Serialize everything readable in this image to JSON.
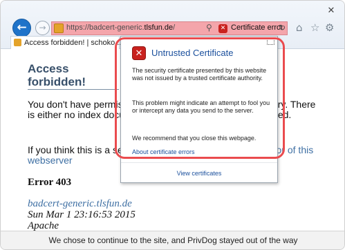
{
  "window": {
    "close_glyph": "✕"
  },
  "toolbar": {
    "back_glyph": "←",
    "forward_glyph": "→",
    "home_icon": "⌂",
    "favorites_icon": "☆",
    "settings_icon": "⚙"
  },
  "address_bar": {
    "url_prefix": "https://badcert-generic.",
    "url_domain": "tlsfun.de",
    "url_suffix": "/",
    "search_glyph": "⚲",
    "shield_glyph": "✕",
    "cert_error_label": "Certificate error",
    "refresh_glyph": "↻"
  },
  "tab": {
    "label": "Access forbidden! | schoko..."
  },
  "page": {
    "title": "Access forbidden!",
    "para1": "You don't have permission to access the requested directory. There is either no index document or the directory is read-protected.",
    "para2_prefix": "If you think this is a server error, please contact the ",
    "para2_link": "operator of this webserver",
    "error_heading": "Error 403",
    "host": "badcert-generic.tlsfun.de",
    "date": "Sun Mar 1 23:16:53 2015",
    "server": "Apache"
  },
  "popup": {
    "title": "Untrusted Certificate",
    "text1": "The security certificate presented by this website was not issued by a trusted certificate authority.",
    "text2": "This problem might indicate an attempt to fool you or intercept any data you send to the server.",
    "text3": "We recommend that you close this webpage.",
    "link_about": "About certificate errors",
    "link_view": "View certificates",
    "shield_glyph": "✕"
  },
  "caption": "We chose to continue to the site, and PrivDog stayed out of the way",
  "colors": {
    "address_error_bg": "#f4a5ab",
    "annotation": "#ea4b4e",
    "link": "#1a4f9c",
    "title_blue": "#38506a"
  }
}
